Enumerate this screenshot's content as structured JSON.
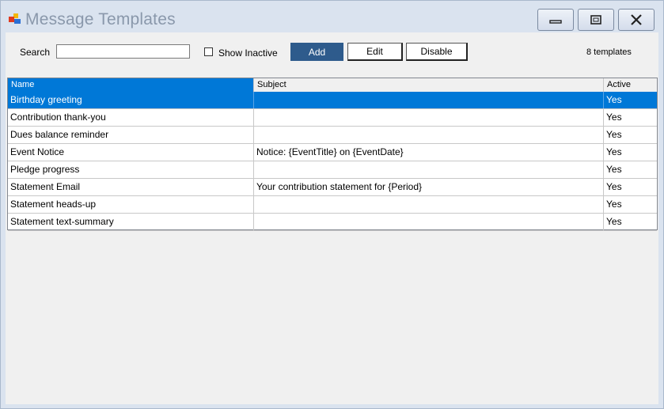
{
  "window": {
    "title": "Message Templates"
  },
  "toolbar": {
    "search_label": "Search",
    "search_value": "",
    "show_inactive_label": "Show Inactive",
    "show_inactive_checked": false,
    "add_label": "Add",
    "edit_label": "Edit",
    "disable_label": "Disable",
    "count_text": "8 templates"
  },
  "colors": {
    "selection": "#0078d7",
    "primary_button": "#2e5b8c",
    "title_text": "#8a98ab"
  },
  "table": {
    "columns": [
      "Name",
      "Subject",
      "Active"
    ],
    "rows": [
      {
        "name": "Birthday greeting",
        "subject": "",
        "active": "Yes",
        "selected": true
      },
      {
        "name": "Contribution thank-you",
        "subject": "",
        "active": "Yes",
        "selected": false
      },
      {
        "name": "Dues balance reminder",
        "subject": "",
        "active": "Yes",
        "selected": false
      },
      {
        "name": "Event Notice",
        "subject": "Notice: {EventTitle} on {EventDate}",
        "active": "Yes",
        "selected": false
      },
      {
        "name": "Pledge progress",
        "subject": "",
        "active": "Yes",
        "selected": false
      },
      {
        "name": "Statement Email",
        "subject": "Your contribution statement for {Period}",
        "active": "Yes",
        "selected": false
      },
      {
        "name": "Statement heads-up",
        "subject": "",
        "active": "Yes",
        "selected": false
      },
      {
        "name": "Statement text-summary",
        "subject": "",
        "active": "Yes",
        "selected": false
      }
    ]
  }
}
